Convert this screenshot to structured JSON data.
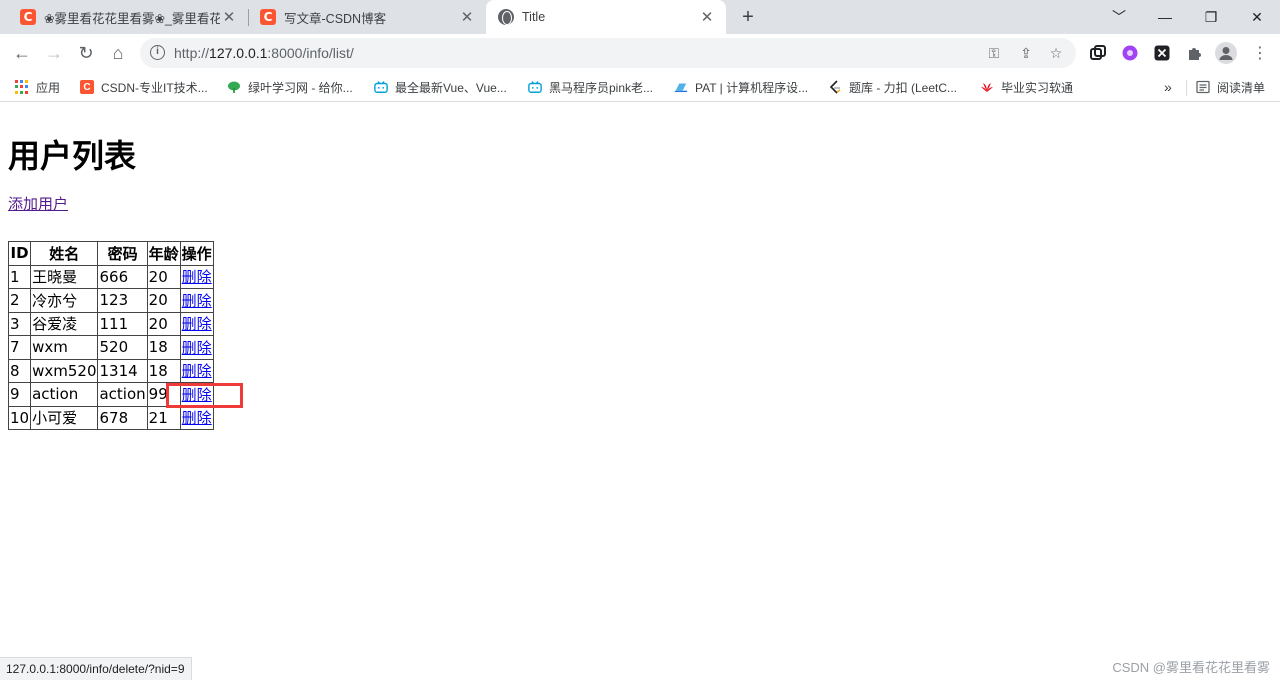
{
  "tabs": [
    {
      "title": "❀雾里看花花里看雾❀_雾里看花",
      "favicon": "csdn-icon"
    },
    {
      "title": "写文章-CSDN博客",
      "favicon": "csdn-icon"
    },
    {
      "title": "Title",
      "favicon": "globe-icon",
      "active": true
    }
  ],
  "address_bar": {
    "url_prefix": "http://",
    "url_host": "127.0.0.1",
    "url_rest": ":8000/info/list/"
  },
  "bookmarks": {
    "apps_label": "应用",
    "items": [
      {
        "label": "CSDN-专业IT技术...",
        "icon": "csdn-icon"
      },
      {
        "label": "绿叶学习网 - 给你...",
        "icon": "leaf-icon"
      },
      {
        "label": "最全最新Vue、Vue...",
        "icon": "bilibili-icon"
      },
      {
        "label": "黑马程序员pink老...",
        "icon": "bilibili-icon"
      },
      {
        "label": "PAT | 计算机程序设...",
        "icon": "pat-icon"
      },
      {
        "label": "题库 - 力扣 (LeetC...",
        "icon": "leetcode-icon"
      },
      {
        "label": "毕业实习软通",
        "icon": "huawei-icon"
      }
    ],
    "overflow": "»",
    "reading_list": "阅读清单"
  },
  "page": {
    "heading": "用户列表",
    "add_link": "添加用户",
    "table": {
      "headers": [
        "ID",
        "姓名",
        "密码",
        "年龄",
        "操作"
      ],
      "rows": [
        {
          "id": "1",
          "name": "王晓曼",
          "password": "666",
          "age": "20",
          "action": "删除"
        },
        {
          "id": "2",
          "name": "冷亦兮",
          "password": "123",
          "age": "20",
          "action": "删除"
        },
        {
          "id": "3",
          "name": "谷爱凌",
          "password": "111",
          "age": "20",
          "action": "删除"
        },
        {
          "id": "7",
          "name": "wxm",
          "password": "520",
          "age": "18",
          "action": "删除"
        },
        {
          "id": "8",
          "name": "wxm520",
          "password": "1314",
          "age": "18",
          "action": "删除"
        },
        {
          "id": "9",
          "name": "action",
          "password": "action",
          "age": "99",
          "action": "删除"
        },
        {
          "id": "10",
          "name": "小可爱",
          "password": "678",
          "age": "21",
          "action": "删除"
        }
      ]
    }
  },
  "status_bar": {
    "hover_url": "127.0.0.1:8000/info/delete/?nid=9"
  },
  "watermark": "CSDN @雾里看花花里看雾",
  "colors": {
    "csdn": "#fc5531",
    "highlight": "#ef3a3a",
    "link": "#0000ee",
    "visited": "#551a8b"
  }
}
